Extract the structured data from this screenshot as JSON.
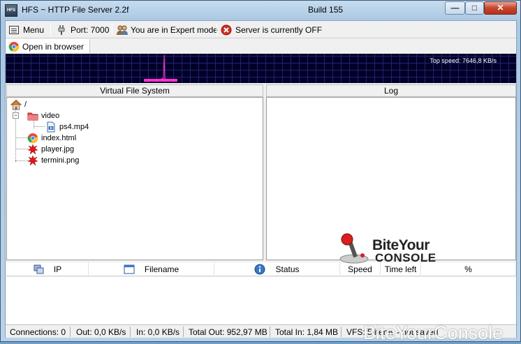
{
  "window": {
    "title": "HFS ~ HTTP File Server 2.2f",
    "build": "Build 155",
    "app_icon_text": "HFS",
    "controls": {
      "minimize": "—",
      "maximize": "□",
      "close": "✕"
    }
  },
  "toolbar": {
    "menu_label": "Menu",
    "port_label": "Port: 7000",
    "mode_label": "You are in Expert mode",
    "server_label": "Server is currently OFF"
  },
  "tabbar": {
    "open_in_browser": "Open in browser"
  },
  "graph": {
    "top_speed": "Top speed: 7646,8 KB/s"
  },
  "vfs": {
    "header": "Virtual File System",
    "root": "/",
    "items": [
      {
        "name": "video",
        "icon": "folder-icon"
      },
      {
        "name": "ps4.mp4",
        "icon": "video-file-icon"
      },
      {
        "name": "index.html",
        "icon": "chrome-icon"
      },
      {
        "name": "player.jpg",
        "icon": "image-file-icon"
      },
      {
        "name": "termini.png",
        "icon": "image-file-icon"
      }
    ]
  },
  "log": {
    "header": "Log"
  },
  "connections": {
    "columns": [
      {
        "label": "IP",
        "icon": "network-icon"
      },
      {
        "label": "Filename",
        "icon": "window-icon"
      },
      {
        "label": "Status",
        "icon": "info-icon"
      },
      {
        "label": "Speed"
      },
      {
        "label": "Time left"
      },
      {
        "label": "%"
      }
    ]
  },
  "status": {
    "connections": "Connections: 0",
    "out": "Out: 0,0 KB/s",
    "in": "In: 0,0 KB/s",
    "total_out": "Total Out: 952,97 MB",
    "total_in": "Total In: 1,84 MB",
    "vfs": "VFS: 5 items - not saved"
  },
  "watermark": {
    "line1": "BiteYour",
    "line2": "CONSOLE",
    "bottom": "BiteYourConsole"
  },
  "colors": {
    "graph_bg": "#000028",
    "graph_grid": "#23236e",
    "graph_signal": "#ff33cc",
    "server_off": "#d32b1e"
  }
}
